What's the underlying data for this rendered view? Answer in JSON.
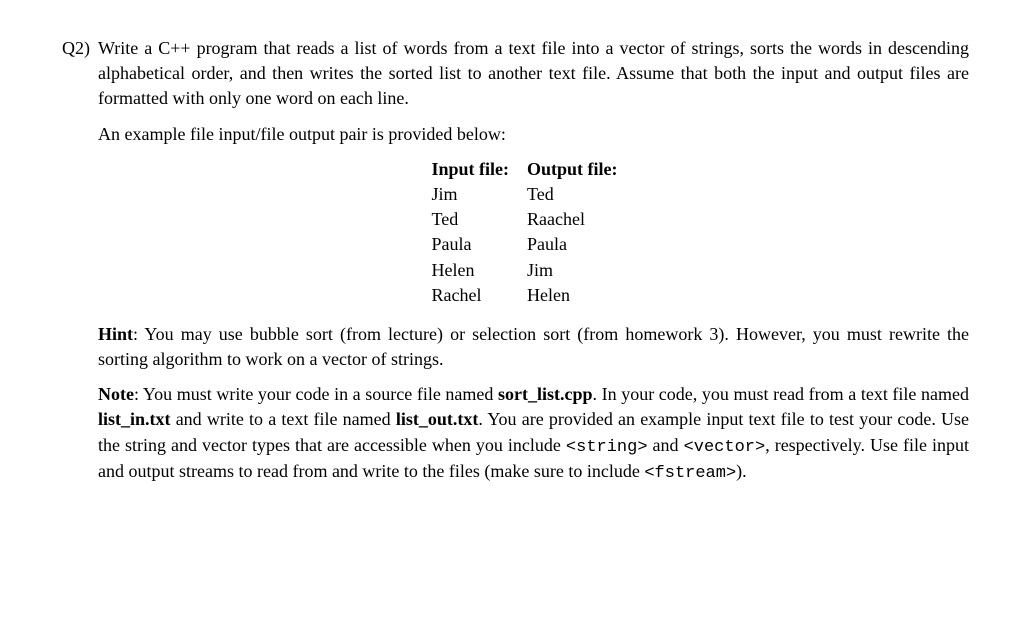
{
  "question": {
    "label": "Q2)",
    "para1": "Write a C++ program that reads a list of words from a text file into a vector of strings, sorts the words in descending alphabetical order, and then writes the sorted list to another text file. Assume that both the input and output files are formatted with only one word on each line.",
    "para2": "An example file input/file output pair is provided below:",
    "table": {
      "header_in": "Input file:",
      "header_out": "Output file:",
      "rows": [
        {
          "in": "Jim",
          "out": "Ted"
        },
        {
          "in": "Ted",
          "out": "Raachel"
        },
        {
          "in": "Paula",
          "out": "Paula"
        },
        {
          "in": "Helen",
          "out": "Jim"
        },
        {
          "in": "Rachel",
          "out": "Helen"
        }
      ]
    },
    "hint_label": "Hint",
    "hint_text": ": You may use bubble sort (from lecture) or selection sort (from homework 3). However, you must rewrite the sorting algorithm to work on a vector of strings.",
    "note_label": "Note",
    "note_pre": ": You must write your code in a source file named ",
    "note_sortlist": "sort_list.cpp",
    "note_a": ". In your code, you must read from a text file named ",
    "note_listin": "list_in.txt",
    "note_b": " and write to a text file named ",
    "note_listout": "list_out.txt",
    "note_c": ". You are provided an example input text file to test your code. Use the string and vector types that are accessible when you include ",
    "note_stringh": "<string>",
    "note_d": " and ",
    "note_vectorh": "<vector>",
    "note_e": ", respectively. Use file input and output streams to read from and write to the files (make sure to include ",
    "note_fstream": "<fstream>",
    "note_f": ")."
  }
}
